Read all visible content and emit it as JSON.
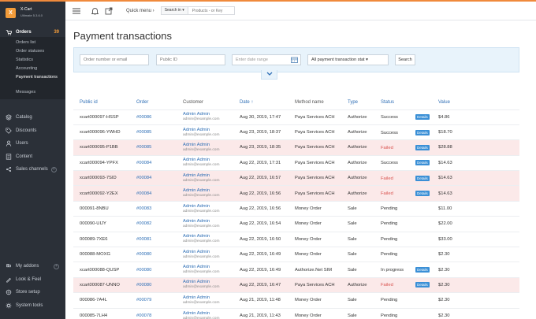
{
  "brand": {
    "name": "X-Cart",
    "version": "Ultimate 5.3.6.0",
    "logo_letter": "X"
  },
  "sidebar": {
    "orders": {
      "label": "Orders",
      "count": "39"
    },
    "orders_sub": [
      "Orders list",
      "Order statuses",
      "Statistics",
      "Accounting",
      "Payment transactions",
      "Messages"
    ],
    "items": [
      {
        "label": "Catalog",
        "icon": "catalog-icon"
      },
      {
        "label": "Discounts",
        "icon": "discounts-icon"
      },
      {
        "label": "Users",
        "icon": "users-icon"
      },
      {
        "label": "Content",
        "icon": "content-icon"
      },
      {
        "label": "Sales channels",
        "icon": "sales-icon"
      }
    ],
    "bottom": [
      {
        "label": "My addons",
        "icon": "addons-icon"
      },
      {
        "label": "Look & Feel",
        "icon": "look-icon"
      },
      {
        "label": "Store setup",
        "icon": "store-icon"
      },
      {
        "label": "System tools",
        "icon": "tools-icon"
      }
    ]
  },
  "topbar": {
    "quick_menu": "Quick menu ›",
    "search_in": "Search in ▾",
    "search_placeholder": "Products - or Key"
  },
  "page": {
    "title": "Payment transactions"
  },
  "filters": {
    "order_placeholder": "Order number or email",
    "public_id_placeholder": "Public ID",
    "date_placeholder": "Enter date range",
    "status_select": "All payment transaction stat ▾",
    "search_button": "Search"
  },
  "table": {
    "headers": [
      "Public id",
      "Order",
      "Customer",
      "Date ↑",
      "Method name",
      "Type",
      "Status",
      "Value"
    ],
    "rows": [
      {
        "pid": "xcart000097-HSSP",
        "order": "#00086",
        "name": "Admin Admin",
        "email": "admin@example.com",
        "date": "Aug 30, 2019, 17:47",
        "method": "Paya Services ACH",
        "type": "Authorize",
        "status": "Success",
        "details": "Details",
        "value": "$4.86",
        "failed": false
      },
      {
        "pid": "xcart000096-YWHD",
        "order": "#00085",
        "name": "Admin Admin",
        "email": "admin@example.com",
        "date": "Aug 23, 2019, 18:37",
        "method": "Paya Services ACH",
        "type": "Authorize",
        "status": "Success",
        "details": "Details",
        "value": "$18.70",
        "failed": false
      },
      {
        "pid": "xcart000095-P1BB",
        "order": "#00085",
        "name": "Admin Admin",
        "email": "admin@example.com",
        "date": "Aug 23, 2019, 18:35",
        "method": "Paya Services ACH",
        "type": "Authorize",
        "status": "Failed",
        "details": "Details",
        "value": "$28.88",
        "failed": true
      },
      {
        "pid": "xcart000094-YPFX",
        "order": "#00084",
        "name": "Admin Admin",
        "email": "admin@example.com",
        "date": "Aug 22, 2019, 17:31",
        "method": "Paya Services ACH",
        "type": "Authorize",
        "status": "Success",
        "details": "Details",
        "value": "$14.63",
        "failed": false
      },
      {
        "pid": "xcart000093-7SID",
        "order": "#00084",
        "name": "Admin Admin",
        "email": "admin@example.com",
        "date": "Aug 22, 2019, 16:57",
        "method": "Paya Services ACH",
        "type": "Authorize",
        "status": "Failed",
        "details": "Details",
        "value": "$14.63",
        "failed": true
      },
      {
        "pid": "xcart000092-Y2EX",
        "order": "#00084",
        "name": "Admin Admin",
        "email": "admin@example.com",
        "date": "Aug 22, 2019, 16:56",
        "method": "Paya Services ACH",
        "type": "Authorize",
        "status": "Failed",
        "details": "Details",
        "value": "$14.63",
        "failed": true
      },
      {
        "pid": "000091-8NBU",
        "order": "#00083",
        "name": "Admin Admin",
        "email": "admin@example.com",
        "date": "Aug 22, 2019, 16:56",
        "method": "Money Order",
        "type": "Sale",
        "status": "Pending",
        "details": "",
        "value": "$11.00",
        "failed": false
      },
      {
        "pid": "000090-UIJY",
        "order": "#00082",
        "name": "Admin Admin",
        "email": "admin@example.com",
        "date": "Aug 22, 2019, 16:54",
        "method": "Money Order",
        "type": "Sale",
        "status": "Pending",
        "details": "",
        "value": "$22.00",
        "failed": false
      },
      {
        "pid": "000089-7XE6",
        "order": "#00081",
        "name": "Admin Admin",
        "email": "admin@example.com",
        "date": "Aug 22, 2019, 16:50",
        "method": "Money Order",
        "type": "Sale",
        "status": "Pending",
        "details": "",
        "value": "$33.00",
        "failed": false
      },
      {
        "pid": "000088-MOXG",
        "order": "#00080",
        "name": "Admin Admin",
        "email": "admin@example.com",
        "date": "Aug 22, 2019, 16:49",
        "method": "Money Order",
        "type": "Sale",
        "status": "Pending",
        "details": "",
        "value": "$2.30",
        "failed": false
      },
      {
        "pid": "xcart000088-QUSP",
        "order": "#00080",
        "name": "Admin Admin",
        "email": "admin@example.com",
        "date": "Aug 22, 2019, 16:49",
        "method": "Authorize.Net SIM",
        "type": "Sale",
        "status": "In progress",
        "details": "Details",
        "value": "$2.30",
        "failed": false
      },
      {
        "pid": "xcart000087-UNNO",
        "order": "#00080",
        "name": "Admin Admin",
        "email": "admin@example.com",
        "date": "Aug 22, 2019, 16:47",
        "method": "Paya Services ACH",
        "type": "Authorize",
        "status": "Failed",
        "details": "Details",
        "value": "$2.30",
        "failed": true
      },
      {
        "pid": "000086-7A4L",
        "order": "#00079",
        "name": "Admin Admin",
        "email": "admin@example.com",
        "date": "Aug 21, 2019, 11:48",
        "method": "Money Order",
        "type": "Sale",
        "status": "Pending",
        "details": "",
        "value": "$2.30",
        "failed": false
      },
      {
        "pid": "000085-7LH4",
        "order": "#00078",
        "name": "Admin Admin",
        "email": "admin@example.com",
        "date": "Aug 21, 2019, 11:43",
        "method": "Money Order",
        "type": "Sale",
        "status": "Pending",
        "details": "",
        "value": "$2.30",
        "failed": false
      }
    ]
  }
}
